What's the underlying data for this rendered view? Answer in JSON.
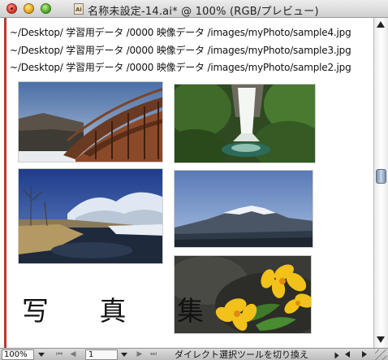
{
  "window": {
    "title": "名称未設定-14.ai* @ 100% (RGB/プレビュー)"
  },
  "canvas": {
    "file_paths": [
      "~/Desktop/ 学習用データ /0000 映像データ /images/myPhoto/sample4.jpg",
      "~/Desktop/ 学習用データ /0000 映像データ /images/myPhoto/sample3.jpg",
      "~/Desktop/ 学習用データ /0000 映像データ /images/myPhoto/sample2.jpg"
    ],
    "collection_title": "写 真 集",
    "photos": [
      {
        "name": "bridge-photo"
      },
      {
        "name": "waterfall-photo"
      },
      {
        "name": "winter-lake-photo"
      },
      {
        "name": "mountain-photo"
      },
      {
        "name": "yellow-flowers-photo"
      }
    ]
  },
  "statusbar": {
    "zoom": "100%",
    "page": "1",
    "status_text": "ダイレクト選択ツールを切り換え"
  },
  "icons": {
    "close": "close-button-icon",
    "minimize": "minimize-button-icon",
    "zoom": "zoom-button-icon",
    "document": "ai-document-icon"
  },
  "colors": {
    "margin_guide": "#b43a30",
    "scroll_thumb": "#7a8ea8"
  }
}
